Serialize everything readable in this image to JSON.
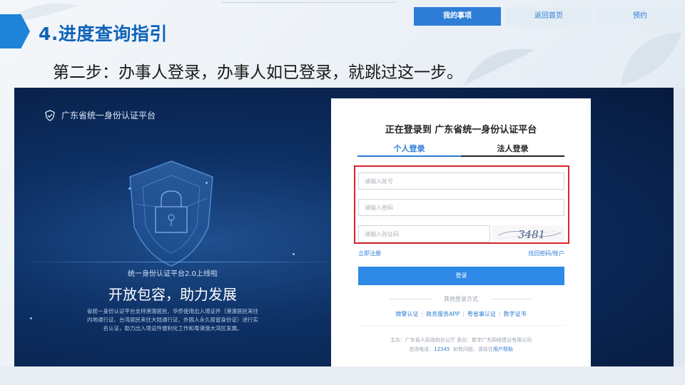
{
  "slide": {
    "title": "4.进度查询指引",
    "step_text": "第二步：办事人登录，办事人如已登录，就跳过这一步。"
  },
  "nav": {
    "mine": "我的事项",
    "home": "返回首页",
    "booking": "预约"
  },
  "platform": {
    "name": "广东省统一身份认证平台",
    "promo_small": "统一身份认证平台2.0上线啦",
    "promo_big": "开放包容，助力发展",
    "promo_desc": "省统一身份认证平台支持港澳居民、华侨使用出入境证件（港澳居民来往内地通行证、台湾居民来往大陆通行证、外国人永久居留身份证）进行实名认证，助力出入境证件便利化工作和粤港澳大湾区发展。"
  },
  "login": {
    "title": "正在登录到 广东省统一身份认证平台",
    "tab_personal": "个人登录",
    "tab_legal": "法人登录",
    "account_placeholder": "请输入账号",
    "password_placeholder": "请输入密码",
    "captcha_placeholder": "请输入验证码",
    "captcha_text": "3481",
    "register": "立即注册",
    "forgot": "找回密码/账户",
    "submit": "登录",
    "other_title": "其他登录方式",
    "methods": [
      "微警认证",
      "政务服务APP",
      "粤省事认证",
      "数字证书"
    ],
    "footer_sponsor": "主办：广东省人民政府办公厅  承办：数字广东网络建设有限公司",
    "footer_phone_label": "咨询电话：",
    "footer_phone": "12345",
    "footer_help_text": "如有问题，请前往",
    "footer_help_link": "用户帮助"
  },
  "colors": {
    "accent": "#2e7dd6",
    "title_blue": "#0e63b8",
    "highlight": "#d8262c",
    "panel_dark": "#0d2f63"
  }
}
